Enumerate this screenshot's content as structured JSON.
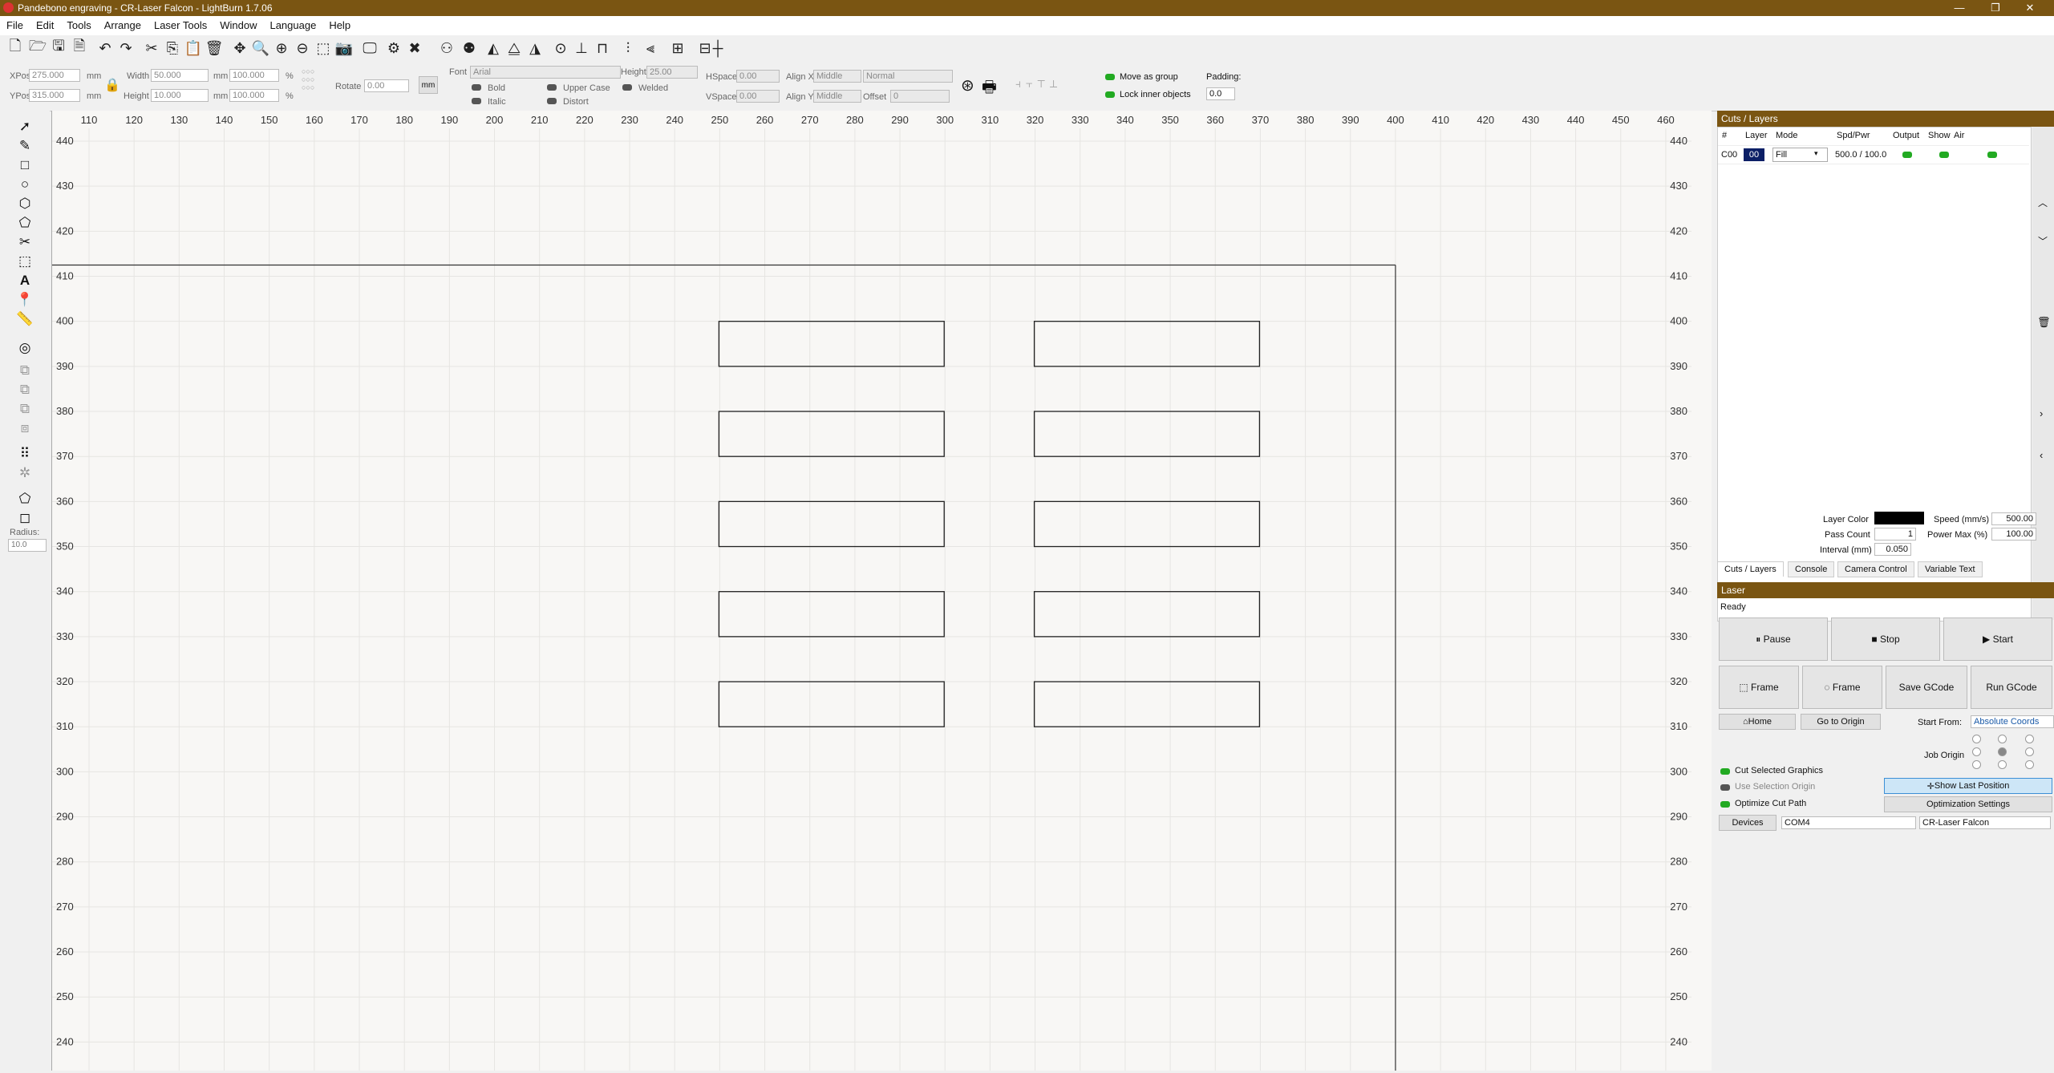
{
  "window": {
    "title": "Pandebono engraving - CR-Laser Falcon - LightBurn 1.7.06",
    "minimize": "—",
    "maximize": "❐",
    "close": "✕"
  },
  "menu": [
    "File",
    "Edit",
    "Tools",
    "Arrange",
    "Laser Tools",
    "Window",
    "Language",
    "Help"
  ],
  "props": {
    "xpos_label": "XPos",
    "xpos": "275.000",
    "ypos_label": "YPos",
    "ypos": "315.000",
    "width_label": "Width",
    "width": "50.000",
    "height_label": "Height",
    "height": "10.000",
    "mm": "mm",
    "pct": "%",
    "scale_w": "100.000",
    "scale_h": "100.000",
    "rotate_label": "Rotate",
    "rotate": "0.00",
    "unit_btn": "mm"
  },
  "text_props": {
    "font_label": "Font",
    "font": "Arial",
    "height_label": "Height",
    "height": "25.00",
    "hspace_label": "HSpace",
    "hspace": "0.00",
    "vspace_label": "VSpace",
    "vspace": "0.00",
    "alignx_label": "Align X",
    "alignx": "Middle",
    "aligny_label": "Align Y",
    "aligny": "Middle",
    "normal": "Normal",
    "offset_label": "Offset",
    "offset": "0",
    "bold": "Bold",
    "italic": "Italic",
    "upper": "Upper Case",
    "distort": "Distort",
    "welded": "Welded"
  },
  "group": {
    "move_as_group": "Move as group",
    "lock_inner": "Lock inner objects",
    "padding_label": "Padding:",
    "padding": "0.0"
  },
  "left": {
    "radius_label": "Radius:",
    "radius": "10.0"
  },
  "ruler": {
    "top": [
      "110",
      "120",
      "130",
      "140",
      "150",
      "160",
      "170",
      "180",
      "190",
      "200",
      "210",
      "220",
      "230",
      "240",
      "250",
      "260",
      "270",
      "280",
      "290",
      "300",
      "310",
      "320",
      "330",
      "340",
      "350",
      "360",
      "370",
      "380",
      "390",
      "400",
      "410",
      "420",
      "430",
      "440",
      "450",
      "460"
    ],
    "left": [
      "440",
      "430",
      "420",
      "410",
      "400",
      "390",
      "380",
      "370",
      "360",
      "350",
      "340",
      "330",
      "320",
      "310",
      "300",
      "290",
      "280",
      "270",
      "260",
      "250",
      "240"
    ]
  },
  "cuts": {
    "title": "Cuts / Layers",
    "headers": [
      "#",
      "Layer",
      "Mode",
      "Spd/Pwr",
      "Output",
      "Show",
      "Air"
    ],
    "row": {
      "num": "C00",
      "layer": "00",
      "mode": "Fill",
      "spdpwr": "500.0 / 100.0"
    },
    "layer_color_label": "Layer Color",
    "speed_label": "Speed (mm/s)",
    "speed": "500.00",
    "pass_label": "Pass Count",
    "pass": "1",
    "powermax_label": "Power Max (%)",
    "powermax": "100.00",
    "interval_label": "Interval (mm)",
    "interval": "0.050",
    "tabs": [
      "Cuts / Layers",
      "Console",
      "Camera Control",
      "Variable Text"
    ]
  },
  "laser": {
    "title": "Laser",
    "status": "Ready",
    "pause": "Pause",
    "stop": "Stop",
    "start": "Start",
    "frame1": "Frame",
    "frame2": "Frame",
    "save_gcode": "Save GCode",
    "run_gcode": "Run GCode",
    "home": "Home",
    "go_origin": "Go to Origin",
    "start_from_label": "Start From:",
    "start_from": "Absolute Coords",
    "job_origin": "Job Origin",
    "cut_selected": "Cut Selected Graphics",
    "use_sel_origin": "Use Selection Origin",
    "optimize_cut": "Optimize Cut Path",
    "show_last": "Show Last Position",
    "opt_settings": "Optimization Settings",
    "devices": "Devices",
    "port": "COM4",
    "device": "CR-Laser Falcon"
  },
  "colors": {
    "title_bg": "#7a5512",
    "layer_black": "#000000",
    "on": "#22aa22"
  }
}
